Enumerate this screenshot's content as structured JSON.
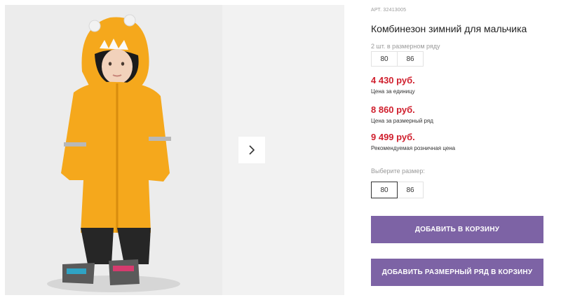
{
  "product": {
    "sku": "АРТ. 32413005",
    "title": "Комбинезон зимний для мальчика",
    "row_count_label": "2 шт. в размерном ряду",
    "row_sizes": [
      "80",
      "86"
    ],
    "prices": [
      {
        "value": "4 430 руб.",
        "label": "Цена за единицу"
      },
      {
        "value": "8 860 руб.",
        "label": "Цена за размерный ряд"
      },
      {
        "value": "9 499 руб.",
        "label": "Рекомендуемая розничная цена"
      }
    ],
    "choose_size_label": "Выберите размер:",
    "size_options": [
      "80",
      "86"
    ],
    "selected_size": "80",
    "add_to_cart_label": "ДОБАВИТЬ В КОРЗИНУ",
    "add_row_to_cart_label": "ДОБАВИТЬ РАЗМЕРНЫЙ РЯД В КОРЗИНУ"
  },
  "gallery": {
    "next_icon": "chevron-right-icon"
  },
  "colors": {
    "price": "#d0202e",
    "button": "#7d63a5",
    "jacket": "#f5a81c"
  }
}
